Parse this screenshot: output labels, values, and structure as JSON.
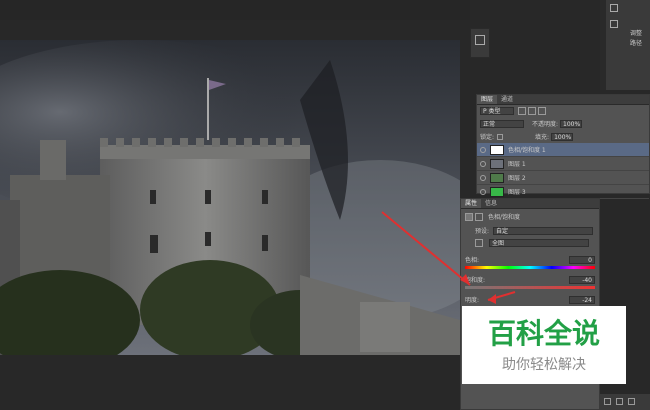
{
  "app": {
    "accent": "#e03030",
    "canvas_bg": "#282828"
  },
  "toolbar_right": {
    "labels": [
      "调整",
      "路径"
    ]
  },
  "layers_panel": {
    "tabs": [
      "图层",
      "通道"
    ],
    "kind_label": "P 类型",
    "blend_mode": "正常",
    "opacity_label": "不透明度:",
    "opacity_value": "100%",
    "lock_label": "锁定:",
    "fill_label": "填充:",
    "fill_value": "100%",
    "layers": [
      {
        "name": "色相/饱和度 1",
        "selected": true
      },
      {
        "name": "图层 1",
        "selected": false
      },
      {
        "name": "图层 2",
        "selected": false
      },
      {
        "name": "图层 3",
        "selected": false
      }
    ]
  },
  "properties_panel": {
    "tabs": [
      "属性",
      "信息"
    ],
    "title": "色相/饱和度",
    "preset_label": "预设:",
    "preset_value": "自定",
    "channel_value": "全图",
    "hue_label": "色相:",
    "hue_value": "0",
    "saturation_label": "饱和度:",
    "saturation_value": "-40",
    "lightness_label": "明度:",
    "lightness_value": "-24"
  },
  "watermark": {
    "title": "百科全说",
    "subtitle": "助你轻松解决",
    "color": "#22a046"
  }
}
